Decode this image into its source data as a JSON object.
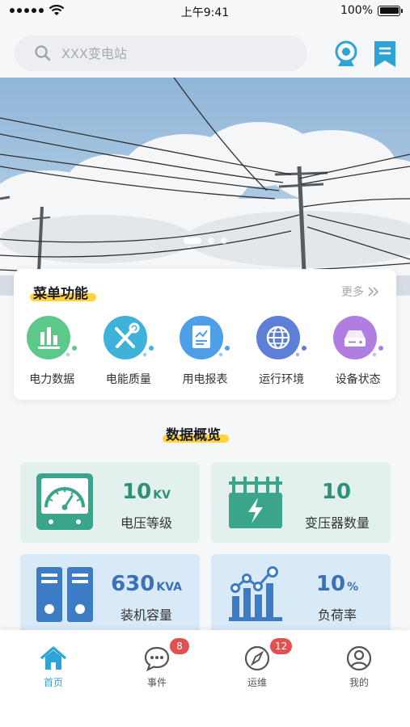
{
  "status_bar": {
    "time": "上午9:41",
    "battery": "100%"
  },
  "search": {
    "placeholder": "XXX变电站"
  },
  "header_icons": [
    "camera-icon",
    "bookmark-icon"
  ],
  "banner": {
    "slides": 3,
    "active_index": 0
  },
  "menu": {
    "title": "菜单功能",
    "more_label": "更多",
    "items": [
      {
        "label": "电力数据",
        "icon": "bar-chart-icon",
        "color": "#5cc98a"
      },
      {
        "label": "电能质量",
        "icon": "tools-icon",
        "color": "#3fb2d9"
      },
      {
        "label": "用电报表",
        "icon": "report-icon",
        "color": "#4f9ee8"
      },
      {
        "label": "运行环境",
        "icon": "globe-icon",
        "color": "#5e7fd6"
      },
      {
        "label": "设备状态",
        "icon": "device-icon",
        "color": "#b07ee0"
      }
    ]
  },
  "overview": {
    "title": "数据概览",
    "stats": [
      {
        "value": "10",
        "unit": "KV",
        "label": "电压等级",
        "icon": "gauge-icon",
        "theme": "green"
      },
      {
        "value": "10",
        "unit": "",
        "label": "变压器数量",
        "icon": "transformer-icon",
        "theme": "green"
      },
      {
        "value": "630",
        "unit": "KVA",
        "label": "装机容量",
        "icon": "cabinet-icon",
        "theme": "blue"
      },
      {
        "value": "10",
        "unit": "%",
        "label": "负荷率",
        "icon": "load-chart-icon",
        "theme": "blue"
      }
    ]
  },
  "tabbar": {
    "items": [
      {
        "label": "首页",
        "icon": "home-icon",
        "active": true,
        "badge": ""
      },
      {
        "label": "事件",
        "icon": "message-icon",
        "active": false,
        "badge": "8"
      },
      {
        "label": "运维",
        "icon": "compass-icon",
        "active": false,
        "badge": "12"
      },
      {
        "label": "我的",
        "icon": "user-icon",
        "active": false,
        "badge": ""
      }
    ]
  },
  "colors": {
    "accent": "#2ea3d6",
    "highlight": "#ffd43b",
    "badge": "#e0524f",
    "green_card": "#e3f1ee",
    "blue_card": "#d8e9f8"
  }
}
